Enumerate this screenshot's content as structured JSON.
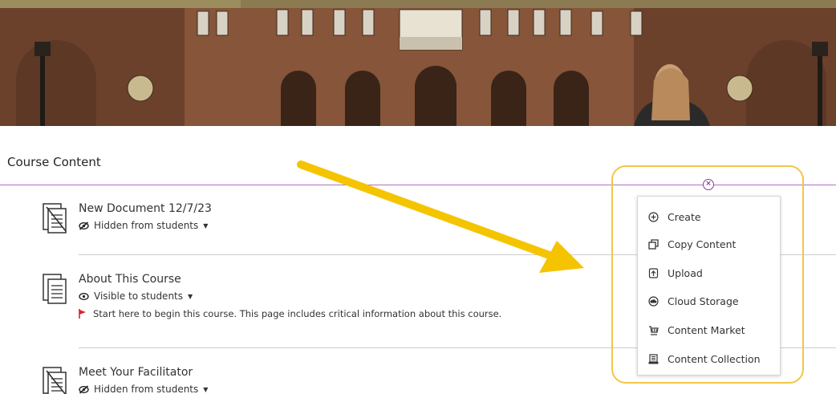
{
  "colors": {
    "purple_accent": "#b46fbf",
    "highlight": "#f2c54a",
    "arrow": "#f5c400",
    "flag_red": "#d9242a"
  },
  "course_content": {
    "title": "Course Content"
  },
  "items": [
    {
      "title": "New Document 12/7/23",
      "visibility": "Hidden from students",
      "visibility_icon": "eye-slash-icon",
      "doc_icon": "document-hidden-icon"
    },
    {
      "title": "About This Course",
      "visibility": "Visible to students",
      "visibility_icon": "eye-icon",
      "doc_icon": "document-icon",
      "description": "Start here to begin this course. This page includes critical information about this course."
    },
    {
      "title": "Meet Your Facilitator",
      "visibility": "Hidden from students",
      "visibility_icon": "eye-slash-icon",
      "doc_icon": "document-hidden-icon"
    }
  ],
  "menu": {
    "items": [
      {
        "label": "Create",
        "icon": "plus-circle-icon"
      },
      {
        "label": "Copy Content",
        "icon": "copy-icon"
      },
      {
        "label": "Upload",
        "icon": "upload-icon"
      },
      {
        "label": "Cloud Storage",
        "icon": "cloud-icon"
      },
      {
        "label": "Content Market",
        "icon": "market-icon"
      },
      {
        "label": "Content Collection",
        "icon": "collection-icon"
      }
    ]
  }
}
